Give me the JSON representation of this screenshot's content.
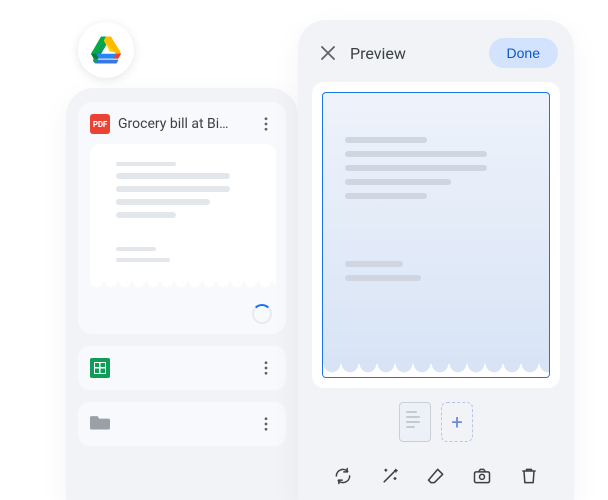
{
  "drive": {
    "file": {
      "badge_text": "PDF",
      "title": "Grocery bill at Bi…"
    }
  },
  "preview": {
    "title": "Preview",
    "done_label": "Done",
    "add_label": "+"
  }
}
